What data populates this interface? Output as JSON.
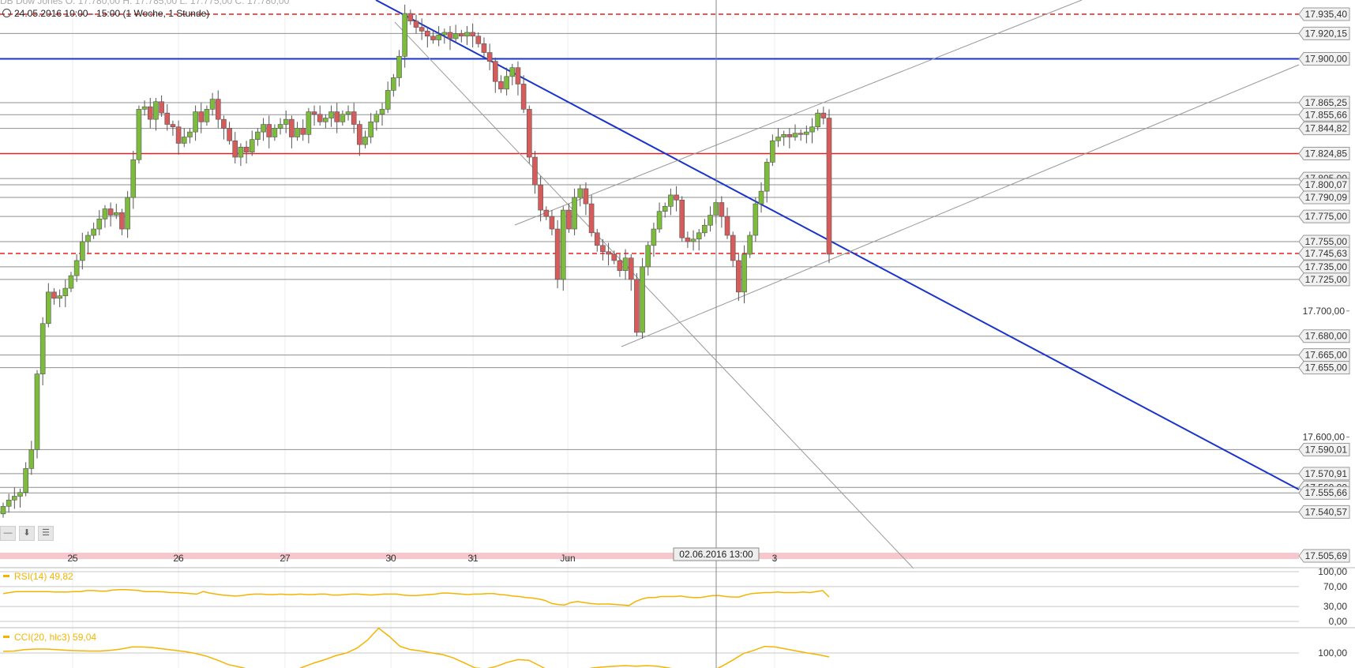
{
  "header": {
    "ohlc": "DB Dow Jones   O: 17.780,00  H: 17.785,00  L: 17.775,00  C: 17.780,00",
    "range": "24.05.2016 10:00 - 15:00 (1 Woche, 1 Stunde)"
  },
  "controls": {
    "zoom_out": "—",
    "download": "⬇",
    "settings": "☰"
  },
  "crosshair_label": "02.06.2016 13:00",
  "colors": {
    "up": "#7dbb3c",
    "down": "#d65c5c",
    "red_line": "#e52020",
    "blue_line": "#1a33cc",
    "indicator": "#f5b400",
    "indicator_fill": "#a6e8a6"
  },
  "chart_data": {
    "type": "candlestick",
    "main_panel": {
      "price_axis_labels": [
        "17.935,40",
        "17.920,15",
        "17.900,00",
        "17.865,25",
        "17.855,66",
        "17.844,82",
        "17.824,85",
        "17.805,00",
        "17.800,07",
        "17.790,09",
        "17.775,00",
        "17.755,00",
        "17.745,63",
        "17.735,00",
        "17.725,00",
        "17.700,00",
        "17.680,00",
        "17.665,00",
        "17.655,00",
        "17.600,00",
        "17.590,01",
        "17.570,91",
        "17.560,00",
        "17.555,66",
        "17.540,57",
        "17.505,69"
      ],
      "price_ticks": [
        {
          "label": "17.700,00",
          "value": 17700
        },
        {
          "label": "17.600,00",
          "value": 17600
        }
      ],
      "x_labels": [
        "25",
        "26",
        "27",
        "30",
        "31",
        "Jun",
        "3"
      ],
      "horizontal_levels": [
        {
          "label": "17.935,40",
          "value": 17935.4,
          "style": "red_dashed"
        },
        {
          "label": "17.920,15",
          "value": 17920.15,
          "style": "gray"
        },
        {
          "label": "17.900,00",
          "value": 17900.0,
          "style": "blue"
        },
        {
          "label": "17.865,25",
          "value": 17865.25,
          "style": "gray"
        },
        {
          "label": "17.855,66",
          "value": 17855.66,
          "style": "gray"
        },
        {
          "label": "17.844,82",
          "value": 17844.82,
          "style": "gray"
        },
        {
          "label": "17.824,85",
          "value": 17824.85,
          "style": "red"
        },
        {
          "label": "17.805,00",
          "value": 17805.0,
          "style": "gray"
        },
        {
          "label": "17.800,07",
          "value": 17800.07,
          "style": "gray"
        },
        {
          "label": "17.790,09",
          "value": 17790.09,
          "style": "gray"
        },
        {
          "label": "17.775,00",
          "value": 17775.0,
          "style": "gray"
        },
        {
          "label": "17.755,00",
          "value": 17755.0,
          "style": "gray"
        },
        {
          "label": "17.745,63",
          "value": 17745.63,
          "style": "red_dashed"
        },
        {
          "label": "17.735,00",
          "value": 17735.0,
          "style": "gray"
        },
        {
          "label": "17.725,00",
          "value": 17725.0,
          "style": "gray"
        },
        {
          "label": "17.680,00",
          "value": 17680.0,
          "style": "gray"
        },
        {
          "label": "17.665,00",
          "value": 17665.0,
          "style": "gray"
        },
        {
          "label": "17.655,00",
          "value": 17655.0,
          "style": "gray"
        },
        {
          "label": "17.590,01",
          "value": 17590.01,
          "style": "gray"
        },
        {
          "label": "17.570,91",
          "value": 17570.91,
          "style": "gray"
        },
        {
          "label": "17.560,00",
          "value": 17560.0,
          "style": "gray"
        },
        {
          "label": "17.555,66",
          "value": 17555.66,
          "style": "gray"
        },
        {
          "label": "17.540,57",
          "value": 17540.57,
          "style": "gray"
        },
        {
          "label": "17.505,69",
          "value": 17505.69,
          "style": "pink_band"
        }
      ],
      "close_series": [
        17545,
        17550,
        17553,
        17556,
        17575,
        17590,
        17650,
        17690,
        17715,
        17710,
        17712,
        17718,
        17728,
        17740,
        17755,
        17760,
        17765,
        17773,
        17781,
        17776,
        17778,
        17765,
        17790,
        17820,
        17860,
        17862,
        17852,
        17866,
        17857,
        17848,
        17846,
        17833,
        17838,
        17842,
        17858,
        17850,
        17860,
        17868,
        17852,
        17845,
        17835,
        17822,
        17830,
        17826,
        17836,
        17842,
        17848,
        17838,
        17845,
        17848,
        17852,
        17838,
        17845,
        17840,
        17858,
        17856,
        17850,
        17853,
        17858,
        17850,
        17856,
        17858,
        17848,
        17832,
        17838,
        17850,
        17856,
        17860,
        17875,
        17885,
        17902,
        17936,
        17930,
        17925,
        17922,
        17918,
        17915,
        17919,
        17921,
        17916,
        17920,
        17918,
        17921,
        17918,
        17912,
        17905,
        17898,
        17882,
        17876,
        17886,
        17893,
        17880,
        17860,
        17822,
        17800,
        17780,
        17775,
        17765,
        17725,
        17780,
        17765,
        17790,
        17797,
        17785,
        17762,
        17752,
        17747,
        17745,
        17740,
        17732,
        17742,
        17725,
        17683,
        17735,
        17752,
        17765,
        17779,
        17783,
        17792,
        17788,
        17758,
        17755,
        17757,
        17762,
        17768,
        17776,
        17786,
        17775,
        17760,
        17740,
        17715,
        17745,
        17760,
        17785,
        17795,
        17818,
        17835,
        17838,
        17840,
        17838,
        17841,
        17840,
        17842,
        17846,
        17857,
        17853,
        17745
      ]
    },
    "rsi_panel": {
      "label": "RSI(14)",
      "last_value": "49,82",
      "y_labels": [
        "100,00",
        "70,00",
        "30,00",
        "0,00"
      ],
      "levels": [
        100,
        70,
        30,
        0
      ],
      "values": [
        56,
        58,
        60,
        60,
        60,
        60,
        60,
        60,
        59,
        59,
        59,
        60,
        60,
        62,
        62,
        61,
        61,
        63,
        64,
        64,
        63,
        62,
        60,
        60,
        60,
        59,
        58,
        58,
        57,
        56,
        55,
        60,
        57,
        55,
        53,
        52,
        51,
        52,
        54,
        55,
        55,
        54,
        54,
        55,
        54,
        54,
        55,
        54,
        54,
        55,
        55,
        53,
        53,
        54,
        55,
        55,
        54,
        53,
        54,
        55,
        55,
        55,
        53,
        52,
        52,
        53,
        54,
        55,
        57,
        57,
        56,
        55,
        54,
        55,
        55,
        56,
        56,
        54,
        53,
        51,
        50,
        48,
        47,
        45,
        42,
        36,
        34,
        33,
        38,
        40,
        38,
        36,
        35,
        35,
        35,
        34,
        33,
        32,
        40,
        45,
        48,
        48,
        50,
        50,
        50,
        51,
        49,
        48,
        48,
        50,
        52,
        52,
        50,
        49,
        49,
        53,
        56,
        57,
        58,
        58,
        59,
        58,
        58,
        58,
        59,
        58,
        60,
        62,
        49
      ]
    },
    "cci_panel": {
      "label": "CCI(20, hlc3)",
      "last_value": "59,04",
      "y_labels": [
        "100,00"
      ],
      "levels": [
        100
      ],
      "values": [
        105,
        106,
        110,
        112,
        112,
        110,
        108,
        107,
        106,
        106,
        108,
        112,
        118,
        118,
        116,
        112,
        108,
        104,
        98,
        90,
        78,
        65,
        58,
        50,
        45,
        40,
        42,
        45,
        58,
        70,
        80,
        92,
        100,
        115,
        140,
        175,
        150,
        120,
        110,
        106,
        100,
        95,
        85,
        70,
        55,
        52,
        60,
        72,
        80,
        78,
        62,
        45,
        40,
        42,
        50,
        55,
        58,
        60,
        62,
        60,
        62,
        60,
        55,
        50,
        48,
        46,
        45,
        60,
        78,
        98,
        108,
        120,
        118,
        112,
        106,
        100,
        95,
        88
      ]
    }
  }
}
